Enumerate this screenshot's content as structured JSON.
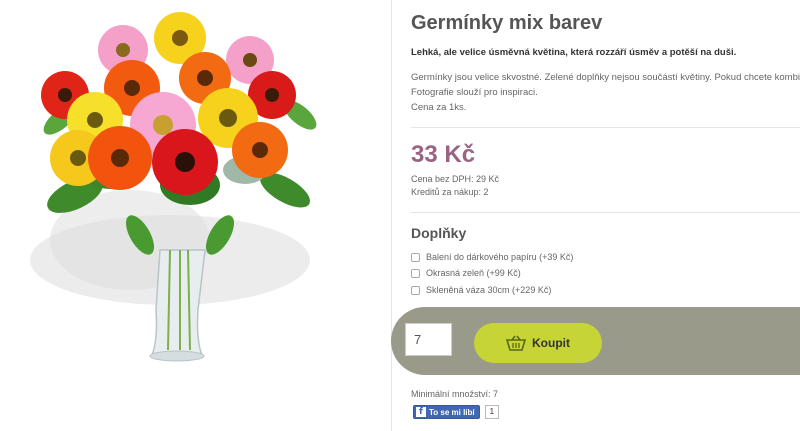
{
  "product": {
    "title": "Germínky mix barev",
    "lead": "Lehká, ale velice úsměvná květina, která rozzáří úsměv a potěší na duši.",
    "description_line1": "Germínky jsou velice skvostné. Zelené doplňky nejsou součástí květiny. Pokud chcete kombinaci",
    "description_line2": "Fotografie slouží pro inspiraci.",
    "unit_price_note": "Cena za 1ks."
  },
  "pricing": {
    "price": "33 Kč",
    "price_without_vat": "Cena bez DPH: 29 Kč",
    "credits": "Kreditů za nákup: 2"
  },
  "addons": {
    "title": "Doplňky",
    "items": [
      {
        "label": "Balení do dárkového papíru (+39 Kč)",
        "checked": false
      },
      {
        "label": "Okrasná zeleň (+99 Kč)",
        "checked": false
      },
      {
        "label": "Skleněná váza 30cm (+229 Kč)",
        "checked": false
      }
    ]
  },
  "purchase": {
    "quantity": "7",
    "buy_label": "Koupit",
    "buy_icon": "basket-icon",
    "min_quantity": "Minimální množství: 7"
  },
  "social": {
    "fb_like_label": "To se mi líbí",
    "fb_like_count": "1",
    "fb_icon": "facebook-icon"
  },
  "colors": {
    "price": "#9b6284",
    "buy_button": "#c7d436",
    "buy_panel": "#999a8a",
    "facebook": "#4267b2"
  }
}
